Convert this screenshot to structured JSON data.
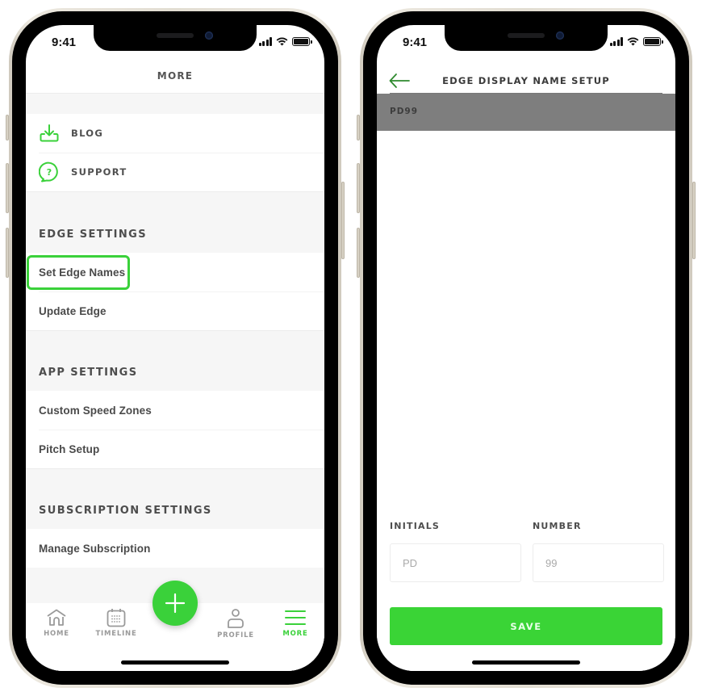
{
  "status_bar": {
    "time": "9:41"
  },
  "left_screen": {
    "nav_title": "MORE",
    "top_links": [
      {
        "label": "BLOG",
        "icon": "download-icon"
      },
      {
        "label": "SUPPORT",
        "icon": "help-bubble-icon"
      }
    ],
    "sections": [
      {
        "title": "EDGE SETTINGS",
        "items": [
          "Set Edge Names",
          "Update Edge"
        ]
      },
      {
        "title": "APP SETTINGS",
        "items": [
          "Custom Speed Zones",
          "Pitch Setup"
        ]
      },
      {
        "title": "SUBSCRIPTION SETTINGS",
        "items": [
          "Manage Subscription"
        ]
      }
    ],
    "highlighted_item": "Set Edge Names",
    "tab_bar": {
      "tabs": [
        {
          "label": "HOME",
          "icon": "home-icon",
          "active": false
        },
        {
          "label": "TIMELINE",
          "icon": "calendar-icon",
          "active": false
        },
        {
          "label": "PROFILE",
          "icon": "person-icon",
          "active": false
        },
        {
          "label": "MORE",
          "icon": "menu-icon",
          "active": true
        }
      ],
      "fab_icon": "plus-icon"
    }
  },
  "right_screen": {
    "nav_title": "EDGE DISPLAY NAME SETUP",
    "back_icon": "arrow-left-icon",
    "list_item": "PD99",
    "form": {
      "initials_label": "INITIALS",
      "initials_placeholder": "PD",
      "initials_value": "",
      "number_label": "NUMBER",
      "number_placeholder": "99",
      "number_value": "",
      "save_label": "SAVE"
    }
  },
  "colors": {
    "accent_green": "#3ad13a",
    "overlay_gray": "#808080",
    "text_dark": "#4d4d4d",
    "tab_inactive": "#9a9a9a"
  }
}
